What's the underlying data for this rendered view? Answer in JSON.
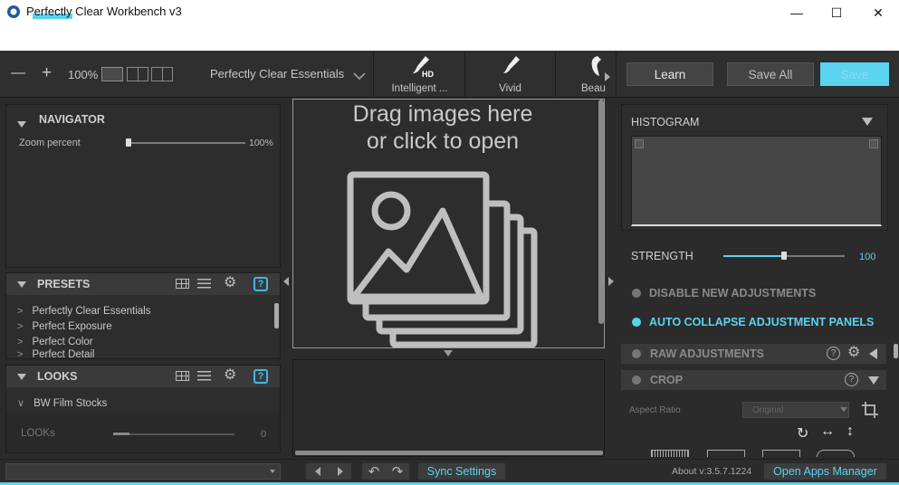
{
  "window": {
    "title": "Perfectly Clear Workbench v3",
    "minimize_glyph": "—",
    "maximize_glyph": "☐",
    "close_glyph": "✕"
  },
  "toolbar": {
    "zoom_out": "—",
    "zoom_in": "+",
    "zoom_level": "100%",
    "preset_select": "Perfectly Clear Essentials",
    "preset_tiles": [
      {
        "label": "Intelligent ...",
        "badge": "HD",
        "icon": "brush-icon"
      },
      {
        "label": "Vivid",
        "badge": "",
        "icon": "brush-icon"
      },
      {
        "label": "Beau",
        "badge": "",
        "icon": "face-icon"
      }
    ],
    "learn": "Learn",
    "save_all": "Save All",
    "save": "Save"
  },
  "navigator": {
    "title": "NAVIGATOR",
    "zoom_label": "Zoom percent",
    "zoom_value": "100%",
    "zoom_fraction": 0.0
  },
  "presets": {
    "title": "PRESETS",
    "items": [
      "Perfectly Clear Essentials",
      "Perfect Exposure",
      "Perfect Color",
      "Perfect Detail"
    ],
    "help": "?"
  },
  "looks": {
    "title": "LOOKS",
    "items": [
      "BW Film Stocks"
    ],
    "slider_label": "LOOKs",
    "slider_value": "0",
    "help": "?"
  },
  "canvas": {
    "drop_line1": "Drag images here",
    "drop_line2": "or click to open"
  },
  "right": {
    "histogram": "HISTOGRAM",
    "strength_label": "STRENGTH",
    "strength_value": "100",
    "strength_fraction": 0.5,
    "disable_new": "DISABLE NEW ADJUSTMENTS",
    "auto_collapse": "AUTO COLLAPSE ADJUSTMENT PANELS",
    "raw": "RAW ADJUSTMENTS",
    "crop": "CROP",
    "aspect_label": "Aspect Ratio",
    "aspect_value": "Original",
    "help": "?"
  },
  "status": {
    "sync": "Sync Settings",
    "version": "About v:3.5.7.1224",
    "open_apps": "Open Apps Manager"
  },
  "colors": {
    "accent": "#5ad3ef",
    "help_blue": "#40b7e0",
    "panel": "#2d2d2d",
    "header": "#3a3a3a"
  }
}
